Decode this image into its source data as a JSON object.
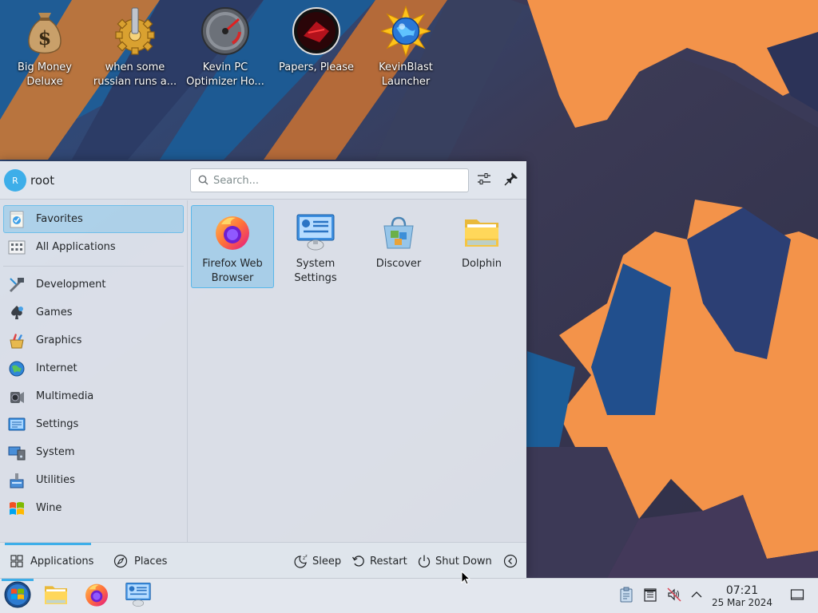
{
  "colors": {
    "accent": "#3daee9",
    "wallpaper_orange": "#f3934a",
    "wallpaper_dark": "#3b3a55",
    "wallpaper_blue": "#1f5c95"
  },
  "desktop": {
    "icons": [
      {
        "label": "Big Money\nDeluxe",
        "icon": "money-bag-icon"
      },
      {
        "label": "when some\nrussian runs a...",
        "icon": "gear-icon"
      },
      {
        "label": "Kevin PC\nOptimizer Ho...",
        "icon": "speedometer-icon"
      },
      {
        "label": "Papers, Please",
        "icon": "papers-please-icon"
      },
      {
        "label": "KevinBlast\nLauncher",
        "icon": "globe-star-icon"
      }
    ]
  },
  "launcher": {
    "user": {
      "avatar_initial": "R",
      "name": "root"
    },
    "search": {
      "placeholder": "Search...",
      "value": ""
    },
    "header_buttons": [
      {
        "name": "configure",
        "icon": "sliders-icon"
      },
      {
        "name": "pin",
        "icon": "pin-icon"
      }
    ],
    "categories": [
      {
        "label": "Favorites",
        "icon": "favorites-icon",
        "active": true
      },
      {
        "label": "All Applications",
        "icon": "all-apps-icon",
        "active": false
      },
      {
        "label": "Development",
        "icon": "development-icon",
        "active": false
      },
      {
        "label": "Games",
        "icon": "games-icon",
        "active": false
      },
      {
        "label": "Graphics",
        "icon": "graphics-icon",
        "active": false
      },
      {
        "label": "Internet",
        "icon": "internet-icon",
        "active": false
      },
      {
        "label": "Multimedia",
        "icon": "multimedia-icon",
        "active": false
      },
      {
        "label": "Settings",
        "icon": "settings-icon",
        "active": false
      },
      {
        "label": "System",
        "icon": "system-icon",
        "active": false
      },
      {
        "label": "Utilities",
        "icon": "utilities-icon",
        "active": false
      },
      {
        "label": "Wine",
        "icon": "wine-icon",
        "active": false
      }
    ],
    "favorites": [
      {
        "label": "Firefox Web\nBrowser",
        "icon": "firefox-icon",
        "active": true
      },
      {
        "label": "System\nSettings",
        "icon": "system-settings-icon",
        "active": false
      },
      {
        "label": "Discover",
        "icon": "discover-icon",
        "active": false
      },
      {
        "label": "Dolphin",
        "icon": "folder-icon",
        "active": false
      }
    ],
    "footer": {
      "tabs": [
        {
          "label": "Applications",
          "icon": "grid-icon",
          "active": true
        },
        {
          "label": "Places",
          "icon": "compass-icon",
          "active": false
        }
      ],
      "power": {
        "sleep": "Sleep",
        "restart": "Restart",
        "shutdown": "Shut Down"
      }
    }
  },
  "taskbar": {
    "items": [
      {
        "name": "start-menu",
        "icon": "start-orb-icon"
      },
      {
        "name": "dolphin",
        "icon": "folder-icon"
      },
      {
        "name": "firefox",
        "icon": "firefox-icon"
      },
      {
        "name": "system-settings",
        "icon": "system-settings-icon"
      }
    ],
    "tray": [
      "clipboard-icon",
      "notes-icon",
      "volume-muted-icon",
      "chevron-up-icon"
    ],
    "clock": {
      "time": "07:21",
      "date": "25 Mar 2024"
    }
  }
}
